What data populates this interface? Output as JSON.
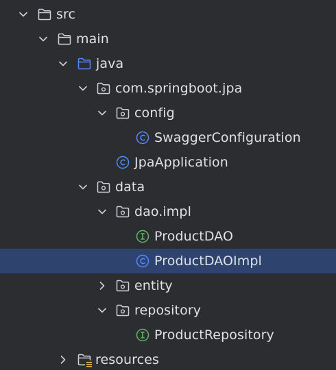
{
  "tree": {
    "nodes": [
      {
        "label": "src",
        "icon": "folder-icon",
        "expanded": true
      },
      {
        "label": "main",
        "icon": "folder-icon",
        "expanded": true
      },
      {
        "label": "java",
        "icon": "source-folder-icon",
        "expanded": true
      },
      {
        "label": "com.springboot.jpa",
        "icon": "package-icon",
        "expanded": true
      },
      {
        "label": "config",
        "icon": "package-icon",
        "expanded": true
      },
      {
        "label": "SwaggerConfiguration",
        "icon": "class-icon"
      },
      {
        "label": "JpaApplication",
        "icon": "class-icon"
      },
      {
        "label": "data",
        "icon": "package-icon",
        "expanded": true
      },
      {
        "label": "dao.impl",
        "icon": "package-icon",
        "expanded": true
      },
      {
        "label": "ProductDAO",
        "icon": "interface-icon"
      },
      {
        "label": "ProductDAOImpl",
        "icon": "class-icon",
        "selected": true
      },
      {
        "label": "entity",
        "icon": "package-icon",
        "expanded": false
      },
      {
        "label": "repository",
        "icon": "package-icon",
        "expanded": true
      },
      {
        "label": "ProductRepository",
        "icon": "interface-icon"
      },
      {
        "label": "resources",
        "icon": "resources-folder-icon",
        "expanded": false
      }
    ]
  },
  "colors": {
    "background": "#2b2d30",
    "selection": "#2e436e",
    "text": "#dfe1e5",
    "class_icon": "#548af7",
    "interface_icon": "#5fb865",
    "source_folder": "#548af7"
  }
}
